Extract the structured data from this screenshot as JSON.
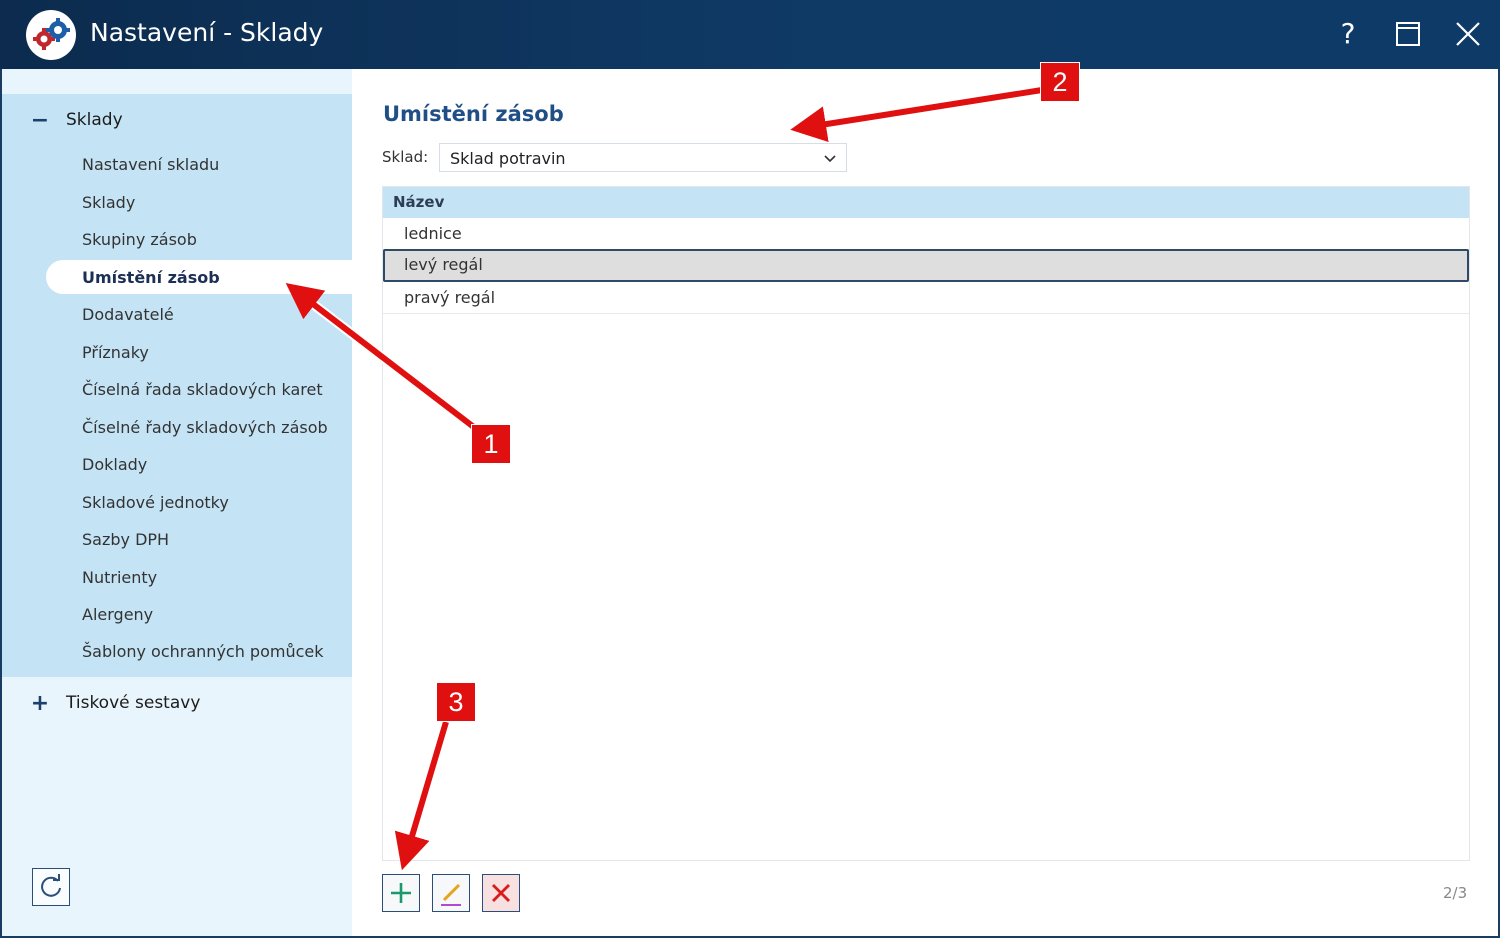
{
  "window": {
    "title": "Nastavení - Sklady",
    "help_label": "?"
  },
  "sidebar": {
    "groups": [
      {
        "label": "Sklady",
        "toggle": "−",
        "expanded": true,
        "items": [
          {
            "label": "Nastavení skladu"
          },
          {
            "label": "Sklady"
          },
          {
            "label": "Skupiny zásob"
          },
          {
            "label": "Umístění zásob",
            "active": true
          },
          {
            "label": "Dodavatelé"
          },
          {
            "label": "Příznaky"
          },
          {
            "label": "Číselná řada skladových karet"
          },
          {
            "label": "Číselné řady skladových zásob"
          },
          {
            "label": "Doklady"
          },
          {
            "label": "Skladové jednotky"
          },
          {
            "label": "Sazby DPH"
          },
          {
            "label": "Nutrienty"
          },
          {
            "label": "Alergeny"
          },
          {
            "label": "Šablony ochranných pomůcek"
          }
        ]
      },
      {
        "label": "Tiskové sestavy",
        "toggle": "+",
        "expanded": false
      }
    ]
  },
  "main": {
    "title": "Umístění zásob",
    "sklad_label": "Sklad:",
    "sklad_value": "Sklad potravin",
    "table": {
      "columns": [
        "Název"
      ],
      "rows": [
        {
          "name": "lednice"
        },
        {
          "name": "levý regál",
          "selected": true
        },
        {
          "name": "pravý regál"
        }
      ]
    },
    "pager": "2/3"
  },
  "annotations": [
    "1",
    "2",
    "3"
  ],
  "colors": {
    "titlebar": "#0f3a66",
    "sidebar_group": "#c4e4f5",
    "accent_title": "#1f4f86",
    "callout": "#e01010",
    "add_icon": "#1a9a6a",
    "delete_icon": "#d91b1b"
  }
}
